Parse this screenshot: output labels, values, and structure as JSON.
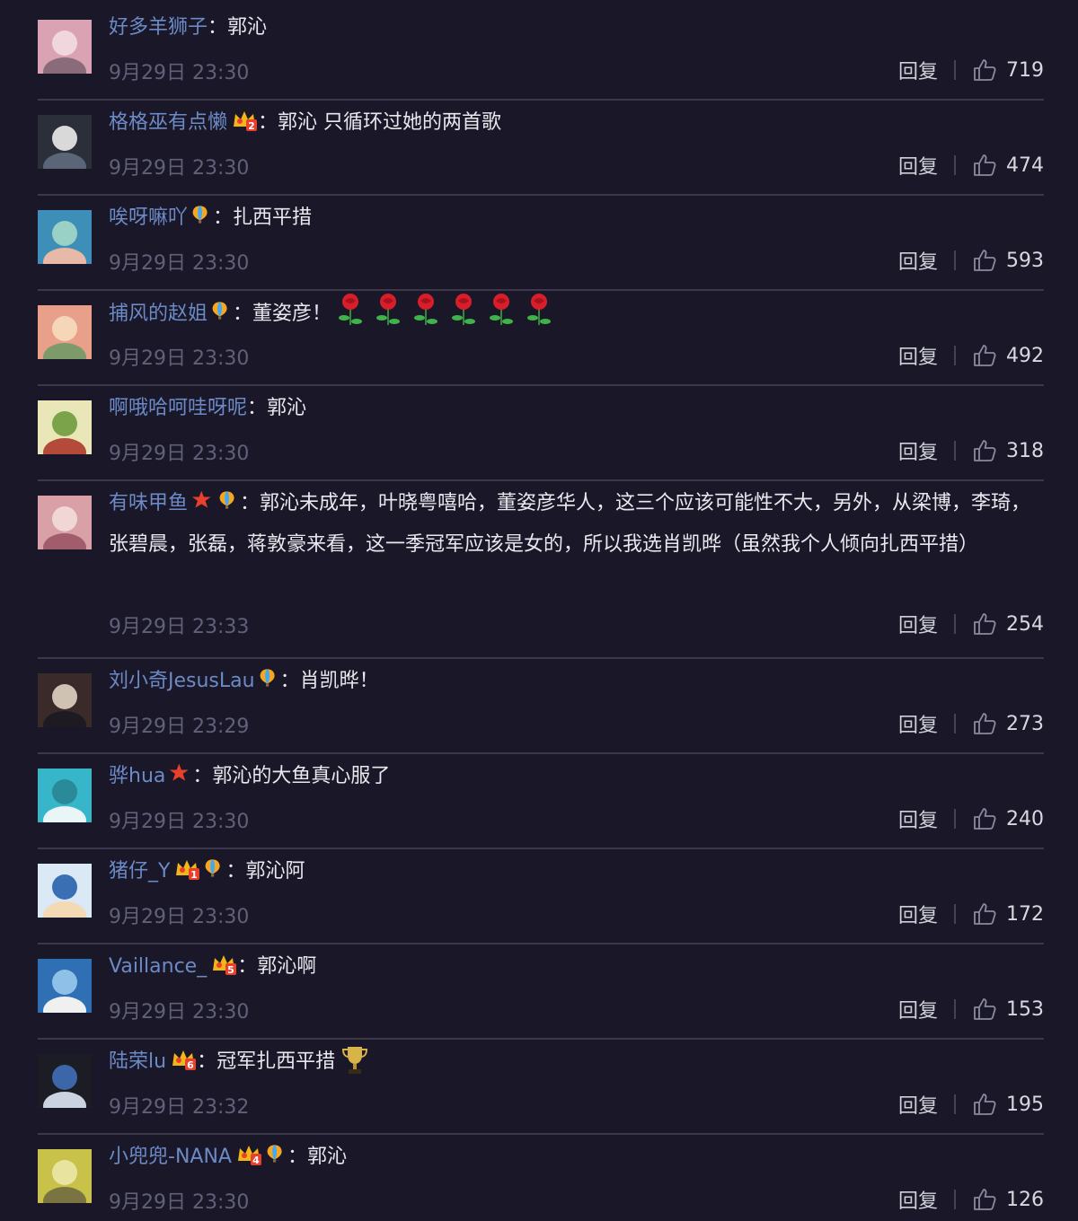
{
  "reply_label": "回复",
  "colors": {
    "background": "#1a1728",
    "username": "#6b8ac6",
    "divider": "#3a384a",
    "timestamp": "#606078"
  },
  "comments": [
    {
      "user": "好多羊狮子",
      "badges": [],
      "sep": "：",
      "text": "郭沁",
      "time": "9月29日 23:30",
      "likes": "719"
    },
    {
      "user": "格格巫有点懒",
      "badges": [
        "vip-crown-2-icon"
      ],
      "sep": "：",
      "text": "郭沁 只循环过她的两首歌",
      "time": "9月29日 23:30",
      "likes": "474"
    },
    {
      "user": "唉呀嘛吖",
      "badges": [
        "balloon-icon"
      ],
      "sep": "：",
      "text": "扎西平措",
      "time": "9月29日 23:30",
      "likes": "593"
    },
    {
      "user": "捕风的赵姐",
      "badges": [
        "balloon-icon"
      ],
      "sep": "：",
      "text": "董姿彦！",
      "inline_emojis": [
        "rose-icon",
        "rose-icon",
        "rose-icon",
        "rose-icon",
        "rose-icon",
        "rose-icon"
      ],
      "time": "9月29日 23:30",
      "likes": "492"
    },
    {
      "user": "啊哦哈呵哇呀呢",
      "badges": [],
      "sep": "：",
      "text": "郭沁",
      "time": "9月29日 23:30",
      "likes": "318"
    },
    {
      "user": "有味甲鱼",
      "badges": [
        "star-icon",
        "balloon-icon"
      ],
      "sep": "：",
      "text": "郭沁未成年，叶晓粤嘻哈，董姿彦华人，这三个应该可能性不大，另外，从梁博，李琦，张碧晨，张磊，蒋敦豪来看，这一季冠军应该是女的，所以我选肖凯晔（虽然我个人倾向扎西平措）",
      "time": "9月29日 23:33",
      "likes": "254"
    },
    {
      "user": "刘小奇JesusLau",
      "badges": [
        "balloon-icon"
      ],
      "sep": "：",
      "text": "肖凯晔！",
      "time": "9月29日 23:29",
      "likes": "273"
    },
    {
      "user": "骅hua",
      "badges": [
        "star-icon"
      ],
      "sep": "：",
      "text": "郭沁的大鱼真心服了",
      "time": "9月29日 23:30",
      "likes": "240"
    },
    {
      "user": "猪仔_Y",
      "badges": [
        "vip-crown-1-icon",
        "balloon-icon"
      ],
      "sep": "：",
      "text": "郭沁阿",
      "time": "9月29日 23:30",
      "likes": "172"
    },
    {
      "user": "Vaillance_",
      "badges": [
        "vip-crown-5-icon"
      ],
      "sep": "：",
      "text": "郭沁啊",
      "time": "9月29日 23:30",
      "likes": "153"
    },
    {
      "user": "陆荣lu",
      "badges": [
        "vip-crown-6-icon"
      ],
      "sep": "：",
      "text": "冠军扎西平措",
      "inline_emojis": [
        "trophy-icon"
      ],
      "time": "9月29日 23:32",
      "likes": "195"
    },
    {
      "user": "小兜兜-NANA",
      "badges": [
        "vip-crown-4-icon",
        "balloon-icon"
      ],
      "sep": "：",
      "text": "郭沁",
      "time": "9月29日 23:30",
      "likes": "126"
    }
  ]
}
